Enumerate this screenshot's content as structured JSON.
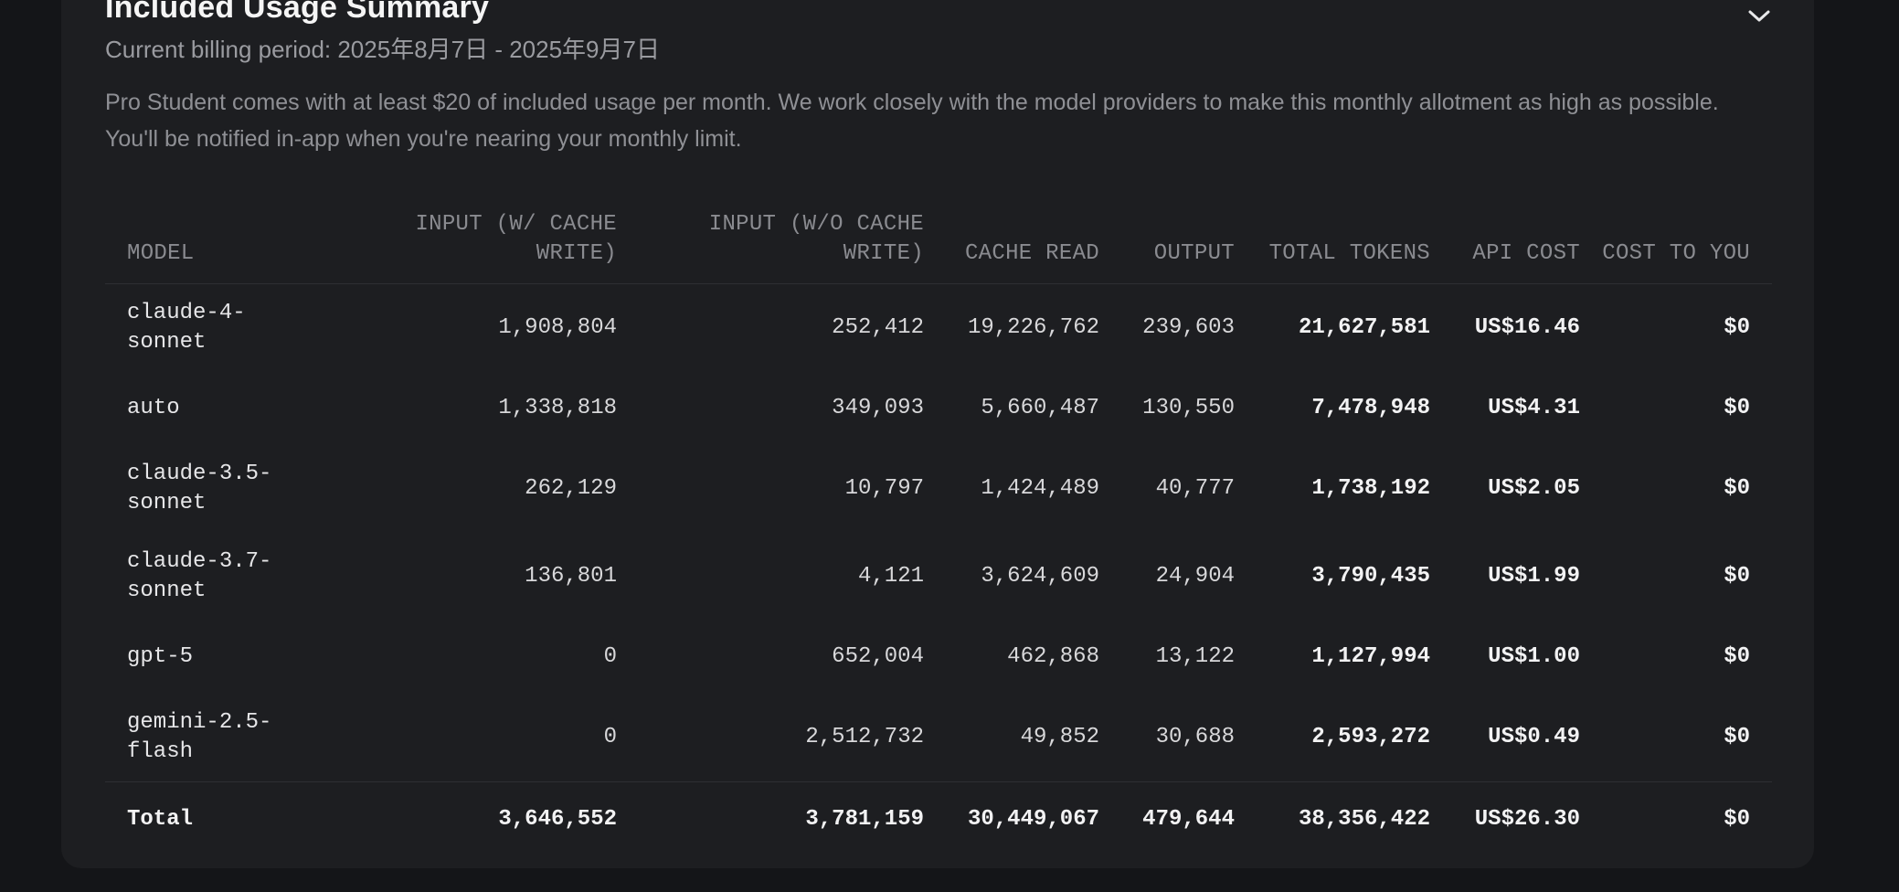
{
  "section": {
    "title": "Included Usage Summary",
    "billing_period": "Current billing period: 2025年8月7日 - 2025年9月7日",
    "description": "Pro Student comes with at least $20 of included usage per month. We work closely with the model providers to make this monthly allotment as high as possible. You'll be notified in-app when you're nearing your monthly limit."
  },
  "table": {
    "headers": {
      "model": "MODEL",
      "input_cache_write": "INPUT (W/ CACHE WRITE)",
      "input_no_cache_write": "INPUT (W/O CACHE WRITE)",
      "cache_read": "CACHE READ",
      "output": "OUTPUT",
      "total_tokens": "TOTAL TOKENS",
      "api_cost": "API COST",
      "cost_to_you": "COST TO YOU"
    },
    "rows": [
      {
        "model": "claude-4-sonnet",
        "input_cache_write": "1,908,804",
        "input_no_cache_write": "252,412",
        "cache_read": "19,226,762",
        "output": "239,603",
        "total_tokens": "21,627,581",
        "api_cost": "US$16.46",
        "cost_to_you": "$0"
      },
      {
        "model": "auto",
        "input_cache_write": "1,338,818",
        "input_no_cache_write": "349,093",
        "cache_read": "5,660,487",
        "output": "130,550",
        "total_tokens": "7,478,948",
        "api_cost": "US$4.31",
        "cost_to_you": "$0"
      },
      {
        "model": "claude-3.5-sonnet",
        "input_cache_write": "262,129",
        "input_no_cache_write": "10,797",
        "cache_read": "1,424,489",
        "output": "40,777",
        "total_tokens": "1,738,192",
        "api_cost": "US$2.05",
        "cost_to_you": "$0"
      },
      {
        "model": "claude-3.7-sonnet",
        "input_cache_write": "136,801",
        "input_no_cache_write": "4,121",
        "cache_read": "3,624,609",
        "output": "24,904",
        "total_tokens": "3,790,435",
        "api_cost": "US$1.99",
        "cost_to_you": "$0"
      },
      {
        "model": "gpt-5",
        "input_cache_write": "0",
        "input_no_cache_write": "652,004",
        "cache_read": "462,868",
        "output": "13,122",
        "total_tokens": "1,127,994",
        "api_cost": "US$1.00",
        "cost_to_you": "$0"
      },
      {
        "model": "gemini-2.5-flash",
        "input_cache_write": "0",
        "input_no_cache_write": "2,512,732",
        "cache_read": "49,852",
        "output": "30,688",
        "total_tokens": "2,593,272",
        "api_cost": "US$0.49",
        "cost_to_you": "$0"
      }
    ],
    "total": {
      "model": "Total",
      "input_cache_write": "3,646,552",
      "input_no_cache_write": "3,781,159",
      "cache_read": "30,449,067",
      "output": "479,644",
      "total_tokens": "38,356,422",
      "api_cost": "US$26.30",
      "cost_to_you": "$0"
    }
  },
  "icons": {
    "collapse": "chevron-down-icon"
  },
  "colors": {
    "background": "#141518",
    "card": "#1d1e21",
    "heading": "#f5f5f5",
    "muted_text": "#8f9095",
    "divider": "#2e2f33"
  }
}
